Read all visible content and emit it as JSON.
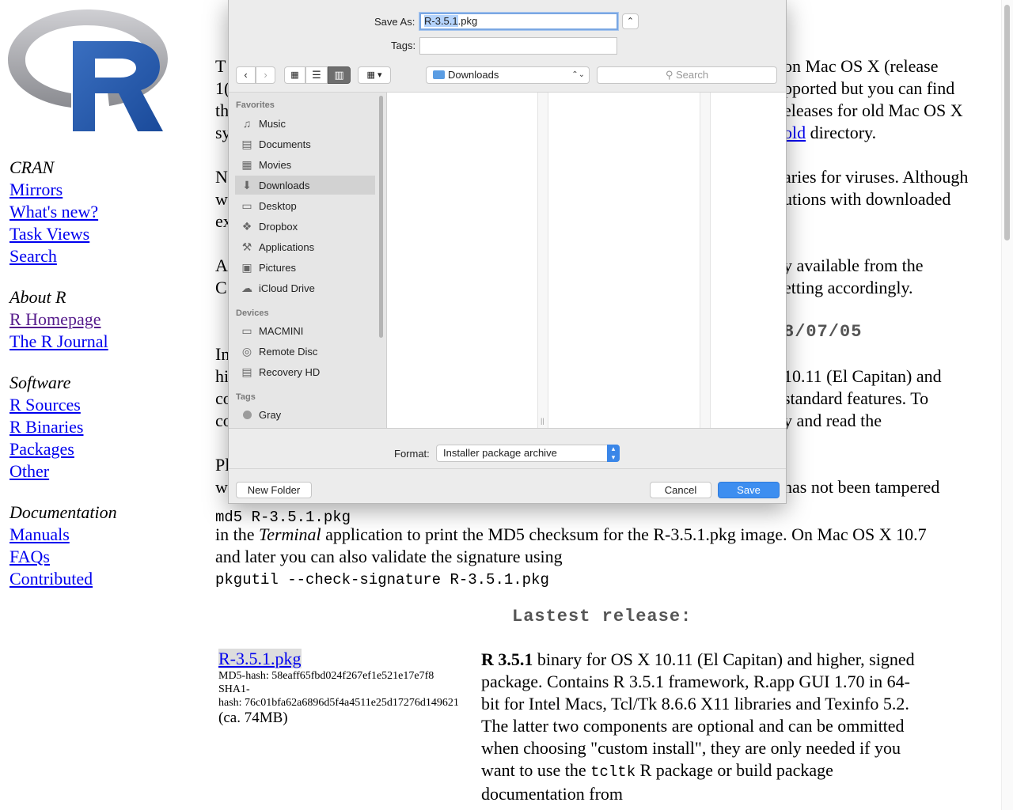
{
  "sidebar": {
    "groups": [
      {
        "title": "CRAN",
        "items": [
          "Mirrors",
          "What's new?",
          "Task Views",
          "Search"
        ]
      },
      {
        "title": "About R",
        "items": [
          "R Homepage",
          "The R Journal"
        ]
      },
      {
        "title": "Software",
        "items": [
          "R Sources",
          "R Binaries",
          "Packages",
          "Other"
        ]
      },
      {
        "title": "Documentation",
        "items": [
          "Manuals",
          "FAQs",
          "Contributed"
        ]
      }
    ]
  },
  "page": {
    "left_fragments": [
      "T",
      "1(",
      "th",
      "sy",
      "",
      "N",
      "w",
      "ex",
      "",
      "A",
      "C",
      "",
      "",
      "In",
      "hi",
      "co",
      "co",
      "",
      "Pl",
      "w"
    ],
    "right_fragments": [
      "on Mac OS X (release",
      "pported but you can find",
      "eleases for old Mac OS X",
      "old directory.",
      "",
      "aries for viruses. Although",
      "utions with downloaded",
      "",
      "",
      "y available from the",
      "etting accordingly.",
      "",
      "8/07/05",
      "",
      "10.11 (El Capitan) and",
      "standard features. To",
      "y and read the",
      "",
      "",
      "has not been tampered"
    ],
    "right_link": "old",
    "md5_cmd": "md5 R-3.5.1.pkg",
    "md5_line_a": "in the ",
    "md5_line_term": "Terminal",
    "md5_line_b": " application to print the MD5 checksum for the R-3.5.1.pkg image. On Mac OS X 10.7",
    "sig_line": "and later you can also validate the signature using",
    "pkgutil_cmd": "pkgutil --check-signature R-3.5.1.pkg",
    "latest_heading": "Lastest release:",
    "release": {
      "file_link": "R-3.5.1.pkg",
      "md5": "MD5-hash: 58eaff65fbd024f267ef1e521e17e7f8",
      "sha1_a": "SHA1-",
      "sha1_b": "hash: 76c01bfa62a6896d5f4a4511e25d17276d149621",
      "size": "(ca. 74MB)",
      "desc_bold": "R 3.5.1",
      "desc_1": " binary for OS X 10.11 (El Capitan) and higher, signed package. Contains R 3.5.1 framework, R.app GUI 1.70 in 64-bit for Intel Macs, Tcl/Tk 8.6.6 X11 libraries and Texinfo 5.2. The latter two components are optional and can be ommitted when choosing \"custom install\", they are only needed if you want to use the ",
      "desc_code": "tcltk",
      "desc_2": " R package or build package documentation from"
    }
  },
  "dialog": {
    "save_as_label": "Save As:",
    "save_as_selected": "R-3.5.1",
    "save_as_rest": ".pkg",
    "tags_label": "Tags:",
    "tags_value": "",
    "location": "Downloads",
    "search_placeholder": "Search",
    "favorites_header": "Favorites",
    "favorites": [
      {
        "label": "Music",
        "icon": "music-icon",
        "glyph": "♫"
      },
      {
        "label": "Documents",
        "icon": "documents-icon",
        "glyph": "▤"
      },
      {
        "label": "Movies",
        "icon": "movies-icon",
        "glyph": "▦"
      },
      {
        "label": "Downloads",
        "icon": "downloads-icon",
        "glyph": "⬇",
        "selected": true
      },
      {
        "label": "Desktop",
        "icon": "desktop-icon",
        "glyph": "▭"
      },
      {
        "label": "Dropbox",
        "icon": "dropbox-icon",
        "glyph": "❖"
      },
      {
        "label": "Applications",
        "icon": "applications-icon",
        "glyph": "⚒"
      },
      {
        "label": "Pictures",
        "icon": "pictures-icon",
        "glyph": "▣"
      },
      {
        "label": "iCloud Drive",
        "icon": "cloud-icon",
        "glyph": "☁"
      }
    ],
    "devices_header": "Devices",
    "devices": [
      {
        "label": "MACMINI",
        "icon": "computer-icon",
        "glyph": "▭"
      },
      {
        "label": "Remote Disc",
        "icon": "disc-icon",
        "glyph": "◎"
      },
      {
        "label": "Recovery HD",
        "icon": "drive-icon",
        "glyph": "▤"
      }
    ],
    "tags_header": "Tags",
    "tag_items": [
      {
        "label": "Gray",
        "color": "#9b9b9b"
      }
    ],
    "format_label": "Format:",
    "format_value": "Installer package archive",
    "new_folder": "New Folder",
    "cancel": "Cancel",
    "save": "Save"
  },
  "colors": {
    "link": "#0000ee",
    "visited": "#551a8b",
    "accent": "#3d8ef0"
  }
}
